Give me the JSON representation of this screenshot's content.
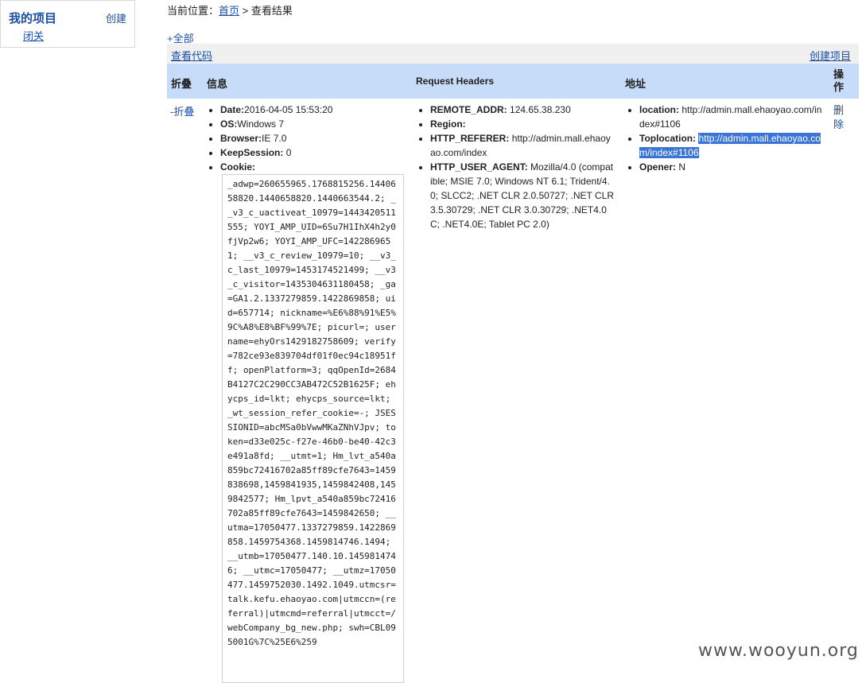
{
  "sidebar": {
    "title": "我的项目",
    "create": "创建",
    "close": "闭关"
  },
  "breadcrumb": {
    "prefix": "当前位置：",
    "home": "首页",
    "sep": " > ",
    "current": "查看结果"
  },
  "toolbar": {
    "all": "+全部",
    "view_code": "查看代码",
    "create_project": "创建项目"
  },
  "table": {
    "headers": {
      "fold": "折叠",
      "info": "信息",
      "request_headers": "Request Headers",
      "address": "地址",
      "operation": "操作"
    },
    "row": {
      "fold": "-折叠",
      "delete": "删除",
      "info": {
        "date_label": "Date:",
        "date": "2016-04-05 15:53:20",
        "os_label": "OS:",
        "os": "Windows 7",
        "browser_label": "Browser:",
        "browser": "IE 7.0",
        "keepsession_label": "KeepSession:",
        "keepsession": "0",
        "cookie_label": "Cookie:",
        "cookie": "_adwp=260655965.1768815256.1440658820.1440658820.1440663544.2; __v3_c_uactiveat_10979=1443420511555; YOYI_AMP_UID=6Su7H1IhX4h2y0fjVp2w6; YOYI_AMP_UFC=1422869651; __v3_c_review_10979=10; __v3_c_last_10979=1453174521499; __v3_c_visitor=1435304631180458; _ga=GA1.2.1337279859.1422869858; uid=657714; nickname=%E6%88%91%E5%9C%A8%E8%BF%99%7E; picurl=; username=ehyOrs1429182758609; verify=782ce93e839704df01f0ec94c18951ff; openPlatform=3; qqOpenId=2684B4127C2C290CC3AB472C52B1625F; ehycps_id=lkt; ehycps_source=lkt; _wt_session_refer_cookie=-; JSESSIONID=abcMSa0bVwwMKaZNhVJpv; token=d33e025c-f27e-46b0-be40-42c3e491a8fd; __utmt=1; Hm_lvt_a540a859bc72416702a85ff89cfe7643=1459838698,1459841935,1459842408,1459842577; Hm_lpvt_a540a859bc72416702a85ff89cfe7643=1459842650; __utma=17050477.1337279859.1422869858.1459754368.1459814746.1494; __utmb=17050477.140.10.1459814746; __utmc=17050477; __utmz=17050477.1459752030.1492.1049.utmcsr=talk.kefu.ehaoyao.com|utmccn=(referral)|utmcmd=referral|utmcct=/webCompany_bg_new.php; swh=CBL095001G%7C%25E6%259"
      },
      "request": {
        "remote_addr_label": "REMOTE_ADDR:",
        "remote_addr": "124.65.38.230",
        "region_label": "Region:",
        "region": "",
        "referer_label": "HTTP_REFERER:",
        "referer": "http://admin.mall.ehaoyao.com/index",
        "ua_label": "HTTP_USER_AGENT:",
        "ua": "Mozilla/4.0 (compatible; MSIE 7.0; Windows NT 6.1; Trident/4.0; SLCC2; .NET CLR 2.0.50727; .NET CLR 3.5.30729; .NET CLR 3.0.30729; .NET4.0C; .NET4.0E; Tablet PC 2.0)"
      },
      "address": {
        "location_label": "location:",
        "location": "http://admin.mall.ehaoyao.com/index#1106",
        "toplocation_label": "Toplocation:",
        "toplocation": "http://admin.mall.ehaoyao.com/index#1106",
        "opener_label": "Opener:",
        "opener": "N"
      }
    }
  },
  "watermark": "www.wooyun.org",
  "colors": {
    "link": "#1a4fa3",
    "header_bg": "#c6dcf8",
    "toolbar_bg": "#f0f0f0",
    "selection": "#3a74d6"
  }
}
